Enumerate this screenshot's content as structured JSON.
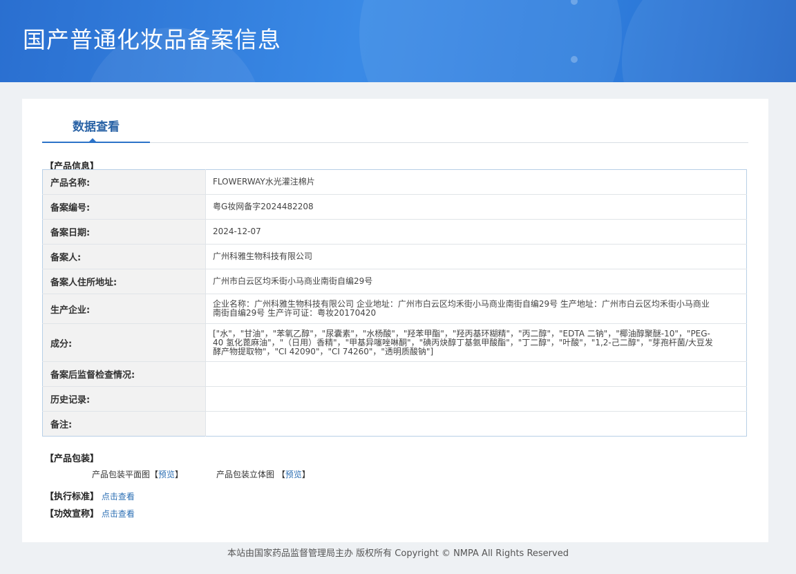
{
  "header": {
    "title": "国产普通化妆品备案信息"
  },
  "tabs": [
    {
      "label": "数据查看"
    }
  ],
  "product_section": {
    "title": "【产品信息】",
    "rows": [
      {
        "label": "产品名称:",
        "value": "FLOWERWAY水光灌注棉片"
      },
      {
        "label": "备案编号:",
        "value": "粤G妆网备字2024482208"
      },
      {
        "label": "备案日期:",
        "value": "2024-12-07"
      },
      {
        "label": "备案人:",
        "value": "广州科雅生物科技有限公司"
      },
      {
        "label": "备案人住所地址:",
        "value": "广州市白云区均禾街小马商业南街自编29号"
      },
      {
        "label": "生产企业:",
        "value": "企业名称：广州科雅生物科技有限公司 企业地址：广州市白云区均禾街小马商业南街自编29号 生产地址：广州市白云区均禾街小马商业南街自编29号 生产许可证：粤妆20170420"
      },
      {
        "label": "成分:",
        "value": "[\"水\"，\"甘油\"，\"苯氧乙醇\"，\"尿囊素\"，\"水杨酸\"，\"羟苯甲酯\"，\"羟丙基环糊精\"，\"丙二醇\"，\"EDTA 二钠\"，\"椰油醇聚醚-10\"，\"PEG-40 氢化蓖麻油\"，\"（日用）香精\"，\"甲基异噻唑啉酮\"，\"碘丙炔醇丁基氨甲酸酯\"，\"丁二醇\"，\"叶酸\"，\"1,2-己二醇\"，\"芽孢杆菌/大豆发酵产物提取物\"，\"CI 42090\"，\"CI 74260\"，\"透明质酸钠\"]"
      },
      {
        "label": "备案后监督检查情况:",
        "value": ""
      },
      {
        "label": "历史记录:",
        "value": ""
      },
      {
        "label": "备注:",
        "value": ""
      }
    ]
  },
  "packaging_section": {
    "title": "【产品包装】",
    "flat_label": "产品包装平面图",
    "solid_label": "产品包装立体图",
    "bracket_open": "【",
    "bracket_close": "】",
    "preview_label": "预览"
  },
  "standard": {
    "label": "【执行标准】",
    "link": "点击查看"
  },
  "efficacy": {
    "label": "【功效宣称】",
    "link": "点击查看"
  },
  "footer": {
    "text": "本站由国家药品监督管理局主办 版权所有 Copyright © NMPA All Rights Reserved"
  },
  "colors": {
    "banner": "#2f7ddc",
    "accent": "#2b72c8",
    "link": "#2c6fb4"
  }
}
